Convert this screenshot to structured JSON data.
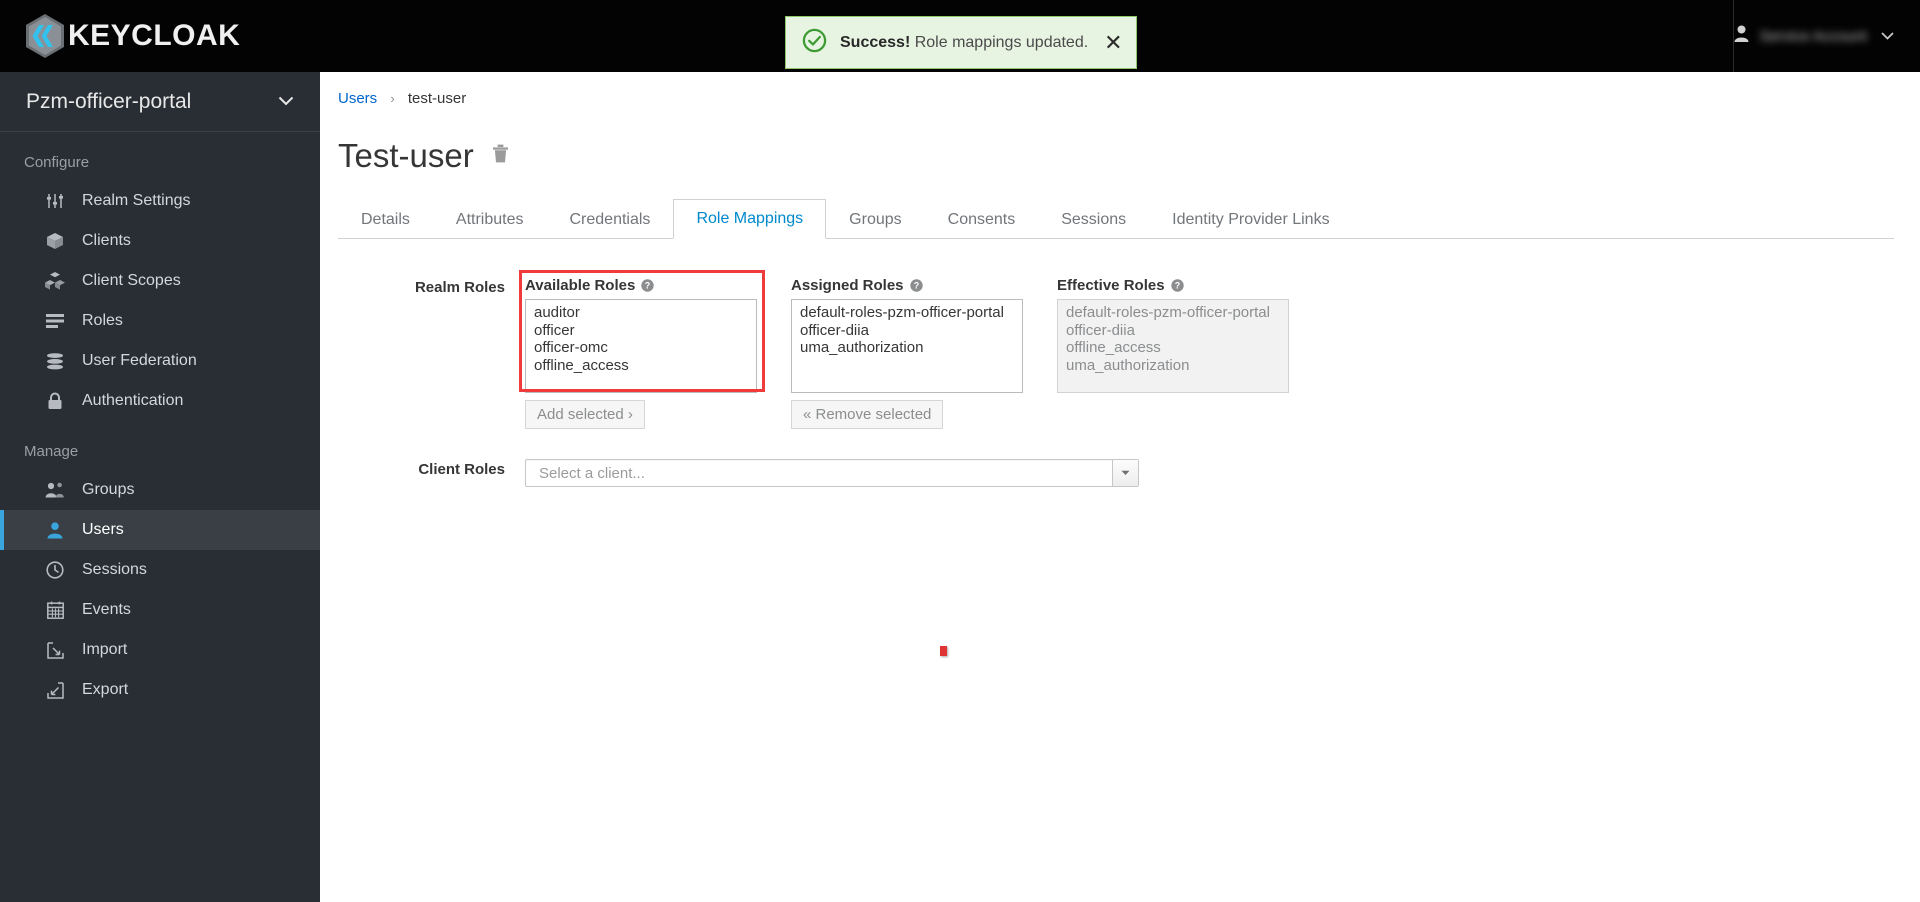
{
  "masthead": {
    "brand": "KEYCLOAK",
    "brand_icon": "keycloak-logo-icon",
    "user_name": "Service Account",
    "user_icon": "user-avatar-icon",
    "caret_icon": "chevron-down-icon"
  },
  "alert": {
    "icon": "check-circle-icon",
    "strong": "Success!",
    "message": "Role mappings updated.",
    "close_label": "✕",
    "border_color": "#8ec86a",
    "bg_color": "#e8f4e2"
  },
  "sidebar": {
    "realm": "Pzm-officer-portal",
    "realm_caret": "chevron-down-icon",
    "groups": [
      {
        "title": "Configure",
        "items": [
          {
            "label": "Realm Settings",
            "icon": "sliders-icon",
            "active": false
          },
          {
            "label": "Clients",
            "icon": "cube-icon",
            "active": false
          },
          {
            "label": "Client Scopes",
            "icon": "cubes-icon",
            "active": false
          },
          {
            "label": "Roles",
            "icon": "list-rows-icon",
            "active": false
          },
          {
            "label": "User Federation",
            "icon": "database-icon",
            "active": false
          },
          {
            "label": "Authentication",
            "icon": "lock-icon",
            "active": false
          }
        ]
      },
      {
        "title": "Manage",
        "items": [
          {
            "label": "Groups",
            "icon": "users-group-icon",
            "active": false
          },
          {
            "label": "Users",
            "icon": "user-icon",
            "active": true
          },
          {
            "label": "Sessions",
            "icon": "clock-icon",
            "active": false
          },
          {
            "label": "Events",
            "icon": "calendar-icon",
            "active": false
          },
          {
            "label": "Import",
            "icon": "import-arrow-icon",
            "active": false
          },
          {
            "label": "Export",
            "icon": "export-arrow-icon",
            "active": false
          }
        ]
      }
    ],
    "active_accent_color": "#39a5dc"
  },
  "breadcrumb": {
    "root": "Users",
    "separator": "›",
    "current": "test-user"
  },
  "page": {
    "title": "Test-user",
    "delete_icon": "trash-icon"
  },
  "tabs": [
    {
      "label": "Details",
      "active": false
    },
    {
      "label": "Attributes",
      "active": false
    },
    {
      "label": "Credentials",
      "active": false
    },
    {
      "label": "Role Mappings",
      "active": true
    },
    {
      "label": "Groups",
      "active": false
    },
    {
      "label": "Consents",
      "active": false
    },
    {
      "label": "Sessions",
      "active": false
    },
    {
      "label": "Identity Provider Links",
      "active": false
    }
  ],
  "form": {
    "realm_roles_label": "Realm Roles",
    "client_roles_label": "Client Roles",
    "available": {
      "heading": "Available Roles",
      "help_icon": "question-circle-icon",
      "options": [
        "auditor",
        "officer",
        "officer-omc",
        "offline_access"
      ],
      "button": "Add selected ›",
      "highlight_color": "#ef3b3b"
    },
    "assigned": {
      "heading": "Assigned Roles",
      "help_icon": "question-circle-icon",
      "options": [
        "default-roles-pzm-officer-portal",
        "officer-diia",
        "uma_authorization"
      ],
      "button": "« Remove selected"
    },
    "effective": {
      "heading": "Effective Roles",
      "help_icon": "question-circle-icon",
      "options": [
        "default-roles-pzm-officer-portal",
        "officer-diia",
        "offline_access",
        "uma_authorization"
      ],
      "disabled": true
    },
    "client_select": {
      "placeholder": "Select a client...",
      "arrow_icon": "caret-down-icon"
    }
  }
}
